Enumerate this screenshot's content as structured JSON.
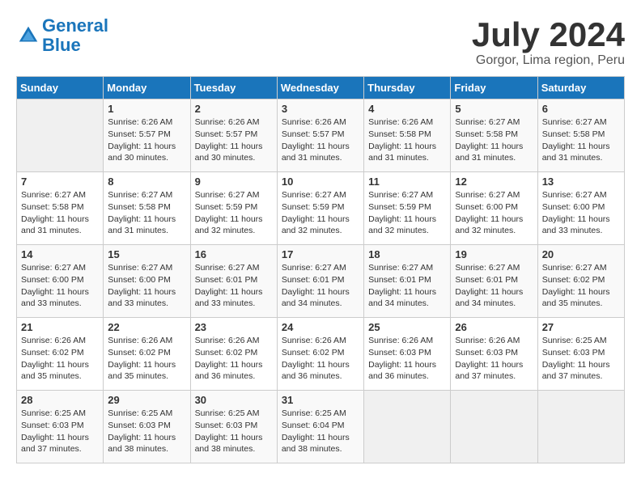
{
  "logo": {
    "line1": "General",
    "line2": "Blue"
  },
  "title": "July 2024",
  "location": "Gorgor, Lima region, Peru",
  "days_of_week": [
    "Sunday",
    "Monday",
    "Tuesday",
    "Wednesday",
    "Thursday",
    "Friday",
    "Saturday"
  ],
  "weeks": [
    [
      {
        "day": "",
        "info": ""
      },
      {
        "day": "1",
        "info": "Sunrise: 6:26 AM\nSunset: 5:57 PM\nDaylight: 11 hours and 30 minutes."
      },
      {
        "day": "2",
        "info": "Sunrise: 6:26 AM\nSunset: 5:57 PM\nDaylight: 11 hours and 30 minutes."
      },
      {
        "day": "3",
        "info": "Sunrise: 6:26 AM\nSunset: 5:57 PM\nDaylight: 11 hours and 31 minutes."
      },
      {
        "day": "4",
        "info": "Sunrise: 6:26 AM\nSunset: 5:58 PM\nDaylight: 11 hours and 31 minutes."
      },
      {
        "day": "5",
        "info": "Sunrise: 6:27 AM\nSunset: 5:58 PM\nDaylight: 11 hours and 31 minutes."
      },
      {
        "day": "6",
        "info": "Sunrise: 6:27 AM\nSunset: 5:58 PM\nDaylight: 11 hours and 31 minutes."
      }
    ],
    [
      {
        "day": "7",
        "info": "Sunrise: 6:27 AM\nSunset: 5:58 PM\nDaylight: 11 hours and 31 minutes."
      },
      {
        "day": "8",
        "info": "Sunrise: 6:27 AM\nSunset: 5:58 PM\nDaylight: 11 hours and 31 minutes."
      },
      {
        "day": "9",
        "info": "Sunrise: 6:27 AM\nSunset: 5:59 PM\nDaylight: 11 hours and 32 minutes."
      },
      {
        "day": "10",
        "info": "Sunrise: 6:27 AM\nSunset: 5:59 PM\nDaylight: 11 hours and 32 minutes."
      },
      {
        "day": "11",
        "info": "Sunrise: 6:27 AM\nSunset: 5:59 PM\nDaylight: 11 hours and 32 minutes."
      },
      {
        "day": "12",
        "info": "Sunrise: 6:27 AM\nSunset: 6:00 PM\nDaylight: 11 hours and 32 minutes."
      },
      {
        "day": "13",
        "info": "Sunrise: 6:27 AM\nSunset: 6:00 PM\nDaylight: 11 hours and 33 minutes."
      }
    ],
    [
      {
        "day": "14",
        "info": "Sunrise: 6:27 AM\nSunset: 6:00 PM\nDaylight: 11 hours and 33 minutes."
      },
      {
        "day": "15",
        "info": "Sunrise: 6:27 AM\nSunset: 6:00 PM\nDaylight: 11 hours and 33 minutes."
      },
      {
        "day": "16",
        "info": "Sunrise: 6:27 AM\nSunset: 6:01 PM\nDaylight: 11 hours and 33 minutes."
      },
      {
        "day": "17",
        "info": "Sunrise: 6:27 AM\nSunset: 6:01 PM\nDaylight: 11 hours and 34 minutes."
      },
      {
        "day": "18",
        "info": "Sunrise: 6:27 AM\nSunset: 6:01 PM\nDaylight: 11 hours and 34 minutes."
      },
      {
        "day": "19",
        "info": "Sunrise: 6:27 AM\nSunset: 6:01 PM\nDaylight: 11 hours and 34 minutes."
      },
      {
        "day": "20",
        "info": "Sunrise: 6:27 AM\nSunset: 6:02 PM\nDaylight: 11 hours and 35 minutes."
      }
    ],
    [
      {
        "day": "21",
        "info": "Sunrise: 6:26 AM\nSunset: 6:02 PM\nDaylight: 11 hours and 35 minutes."
      },
      {
        "day": "22",
        "info": "Sunrise: 6:26 AM\nSunset: 6:02 PM\nDaylight: 11 hours and 35 minutes."
      },
      {
        "day": "23",
        "info": "Sunrise: 6:26 AM\nSunset: 6:02 PM\nDaylight: 11 hours and 36 minutes."
      },
      {
        "day": "24",
        "info": "Sunrise: 6:26 AM\nSunset: 6:02 PM\nDaylight: 11 hours and 36 minutes."
      },
      {
        "day": "25",
        "info": "Sunrise: 6:26 AM\nSunset: 6:03 PM\nDaylight: 11 hours and 36 minutes."
      },
      {
        "day": "26",
        "info": "Sunrise: 6:26 AM\nSunset: 6:03 PM\nDaylight: 11 hours and 37 minutes."
      },
      {
        "day": "27",
        "info": "Sunrise: 6:25 AM\nSunset: 6:03 PM\nDaylight: 11 hours and 37 minutes."
      }
    ],
    [
      {
        "day": "28",
        "info": "Sunrise: 6:25 AM\nSunset: 6:03 PM\nDaylight: 11 hours and 37 minutes."
      },
      {
        "day": "29",
        "info": "Sunrise: 6:25 AM\nSunset: 6:03 PM\nDaylight: 11 hours and 38 minutes."
      },
      {
        "day": "30",
        "info": "Sunrise: 6:25 AM\nSunset: 6:03 PM\nDaylight: 11 hours and 38 minutes."
      },
      {
        "day": "31",
        "info": "Sunrise: 6:25 AM\nSunset: 6:04 PM\nDaylight: 11 hours and 38 minutes."
      },
      {
        "day": "",
        "info": ""
      },
      {
        "day": "",
        "info": ""
      },
      {
        "day": "",
        "info": ""
      }
    ]
  ]
}
